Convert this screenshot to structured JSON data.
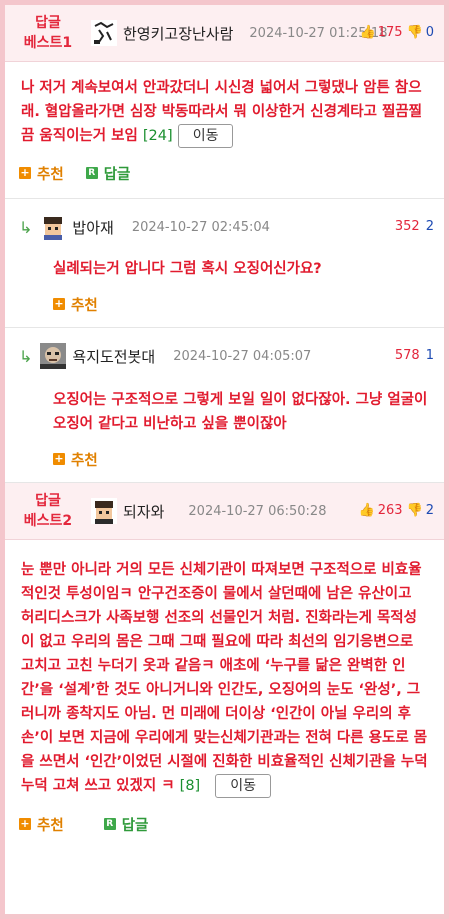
{
  "comment1": {
    "best_line1": "답글",
    "best_line2": "베스트1",
    "nickname": "한영키고장난사람",
    "date": "2024-10-27 01:25:18",
    "likes": "175",
    "dislikes": "0",
    "body": "나 저거 계속보여서 안과갔더니 시신경 넓어서 그렇댔나 암튼 참으래. 혈압올라가면 심장 박동따라서 뭐 이상한거 신경계타고 찔끔찔끔 움직이는거 보임",
    "reply_count": "[24]",
    "move_label": "이동",
    "recommend_label": "추천",
    "reply_label": "답글"
  },
  "reply1": {
    "nickname": "밥아재",
    "date": "2024-10-27 02:45:04",
    "likes": "352",
    "dislikes": "2",
    "body": "실례되는거 압니다 그럼 혹시 오징어신가요?",
    "recommend_label": "추천"
  },
  "reply2": {
    "nickname": "욕지도전봇대",
    "date": "2024-10-27 04:05:07",
    "likes": "578",
    "dislikes": "1",
    "body": "오징어는 구조적으로 그렇게 보일 일이 없다잖아. 그냥 얼굴이 오징어 같다고 비난하고 싶을 뿐이잖아",
    "recommend_label": "추천"
  },
  "comment2": {
    "best_line1": "답글",
    "best_line2": "베스트2",
    "nickname": "되자와",
    "date": "2024-10-27 06:50:28",
    "likes": "263",
    "dislikes": "2",
    "body": "눈 뿐만 아니라 거의 모든 신체기관이 따져보면 구조적으로 비효율적인것 투성이임ㅋ 안구건조증이 물에서 살던때에 남은 유산이고 허리디스크가 사족보행 선조의 선물인거 처럼. 진화라는게 목적성이 없고 우리의 몸은 그때 그때 필요에 따라 최선의 임기응변으로 고치고 고친 누더기 옷과 같음ㅋ 애초에 ‘누구를 닮은 완벽한 인간’을 ‘설계’한 것도 아니거니와 인간도, 오징어의 눈도 ‘완성’, 그러니까 종착지도 아님. 먼 미래에 더이상 ‘인간이 아닐 우리의 후손’이 보면 지금에 우리에게 맞는신체기관과는 전혀 다른 용도로 몸을 쓰면서 ‘인간’이었던 시절에 진화한 비효율적인 신체기관을 누덕누덕 고쳐 쓰고 있겠지 ㅋ",
    "reply_count": "[8]",
    "move_label": "이동",
    "recommend_label": "추천",
    "reply_label": "답글"
  },
  "colors": {
    "border_pink": "#f4c6cc",
    "best_bg": "#fdeff1",
    "text_red": "#e11b2e",
    "up_red": "#e3273c",
    "down_blue": "#1d4ab3",
    "count_green": "#1b8f2f",
    "recommend_orange": "#f08c00",
    "reply_green": "#3ea84a"
  },
  "icons": {
    "thumb_up": "thumbs-up-icon",
    "thumb_down": "thumbs-down-icon",
    "plus": "plus-square-icon",
    "reply": "reply-square-icon",
    "reply_arrow": "reply-arrow-icon"
  }
}
